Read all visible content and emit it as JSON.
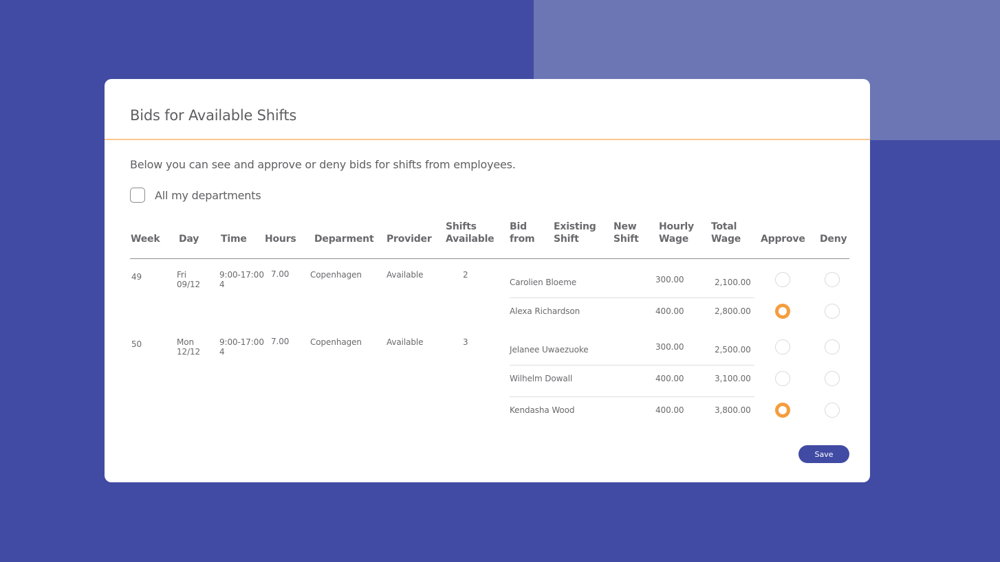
{
  "page": {
    "title": "Bids for Available Shifts",
    "intro": "Below you can see and approve or deny bids for shifts from employees.",
    "all_departments": {
      "label": "All my departments",
      "checked": false
    }
  },
  "colors": {
    "background": "#414ba3",
    "background_accent": "#6d76b5",
    "header_rule": "#fdc58e",
    "radio_selected": "#f59d3d",
    "button": "#414ba3"
  },
  "table": {
    "headers": {
      "week": "Week",
      "day": "Day",
      "time": "Time",
      "hours": "Hours",
      "department": "Deparment",
      "provider": "Provider",
      "shifts_available_1": "Shifts",
      "shifts_available_2": "Available",
      "bid_from_1": "Bid",
      "bid_from_2": "from",
      "existing_shift_1": "Existing",
      "existing_shift_2": "Shift",
      "new_shift_1": "New",
      "new_shift_2": "Shift",
      "hourly_wage_1": "Hourly",
      "hourly_wage_2": "Wage",
      "total_wage_1": "Total",
      "total_wage_2": "Wage",
      "approve": "Approve",
      "deny": "Deny"
    },
    "groups": [
      {
        "week": "49",
        "day_name": "Fri",
        "day_date": "09/12",
        "time_1": "9:00-17:00",
        "time_2": "4",
        "hours": "7.00",
        "department": "Copenhagen",
        "provider": "Available",
        "shifts_available": "2",
        "bids": [
          {
            "name": "Carolien Bloeme",
            "existing_shift": "",
            "new_shift": "",
            "hourly_wage": "300.00",
            "total_wage": "2,100.00",
            "decision": "none"
          },
          {
            "name": "Alexa Richardson",
            "existing_shift": "",
            "new_shift": "",
            "hourly_wage": "400.00",
            "total_wage": "2,800.00",
            "decision": "approve"
          }
        ]
      },
      {
        "week": "50",
        "day_name": "Mon",
        "day_date": "12/12",
        "time_1": "9:00-17:00",
        "time_2": "4",
        "hours": "7.00",
        "department": "Copenhagen",
        "provider": "Available",
        "shifts_available": "3",
        "bids": [
          {
            "name": "Jelanee Uwaezuoke",
            "existing_shift": "",
            "new_shift": "",
            "hourly_wage": "300.00",
            "total_wage": "2,500.00",
            "decision": "none"
          },
          {
            "name": "Wilhelm Dowall",
            "existing_shift": "",
            "new_shift": "",
            "hourly_wage": "400.00",
            "total_wage": "3,100.00",
            "decision": "none"
          },
          {
            "name": "Kendasha Wood",
            "existing_shift": "",
            "new_shift": "",
            "hourly_wage": "400.00",
            "total_wage": "3,800.00",
            "decision": "approve"
          }
        ]
      }
    ]
  },
  "actions": {
    "save_label": "Save"
  }
}
